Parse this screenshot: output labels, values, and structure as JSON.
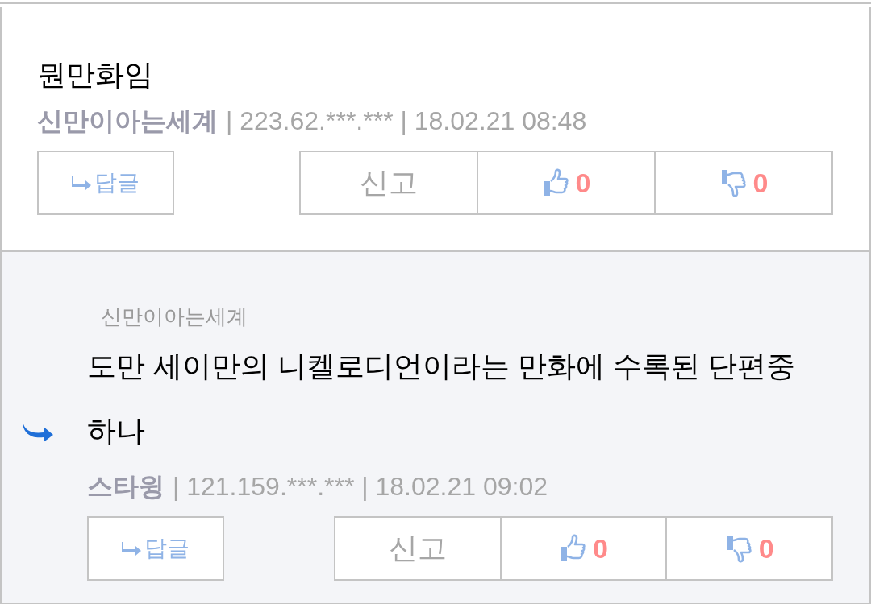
{
  "comments": [
    {
      "kind": "comment",
      "text": "뭔만화임",
      "author": "신만이아는세계",
      "details": "| 223.62.***.*** | 18.02.21 08:48",
      "reply_button": "답글",
      "report_button": "신고",
      "likes": "0",
      "dislikes": "0"
    },
    {
      "kind": "reply",
      "reply_to": "신만이아는세계",
      "text": "도만 세이만의 니켈로디언이라는 만화에 수록된 단편중 하나",
      "author": "스타윙",
      "details": "| 121.159.***.*** | 18.02.21 09:02",
      "reply_button": "답글",
      "report_button": "신고",
      "likes": "0",
      "dislikes": "0"
    }
  ]
}
